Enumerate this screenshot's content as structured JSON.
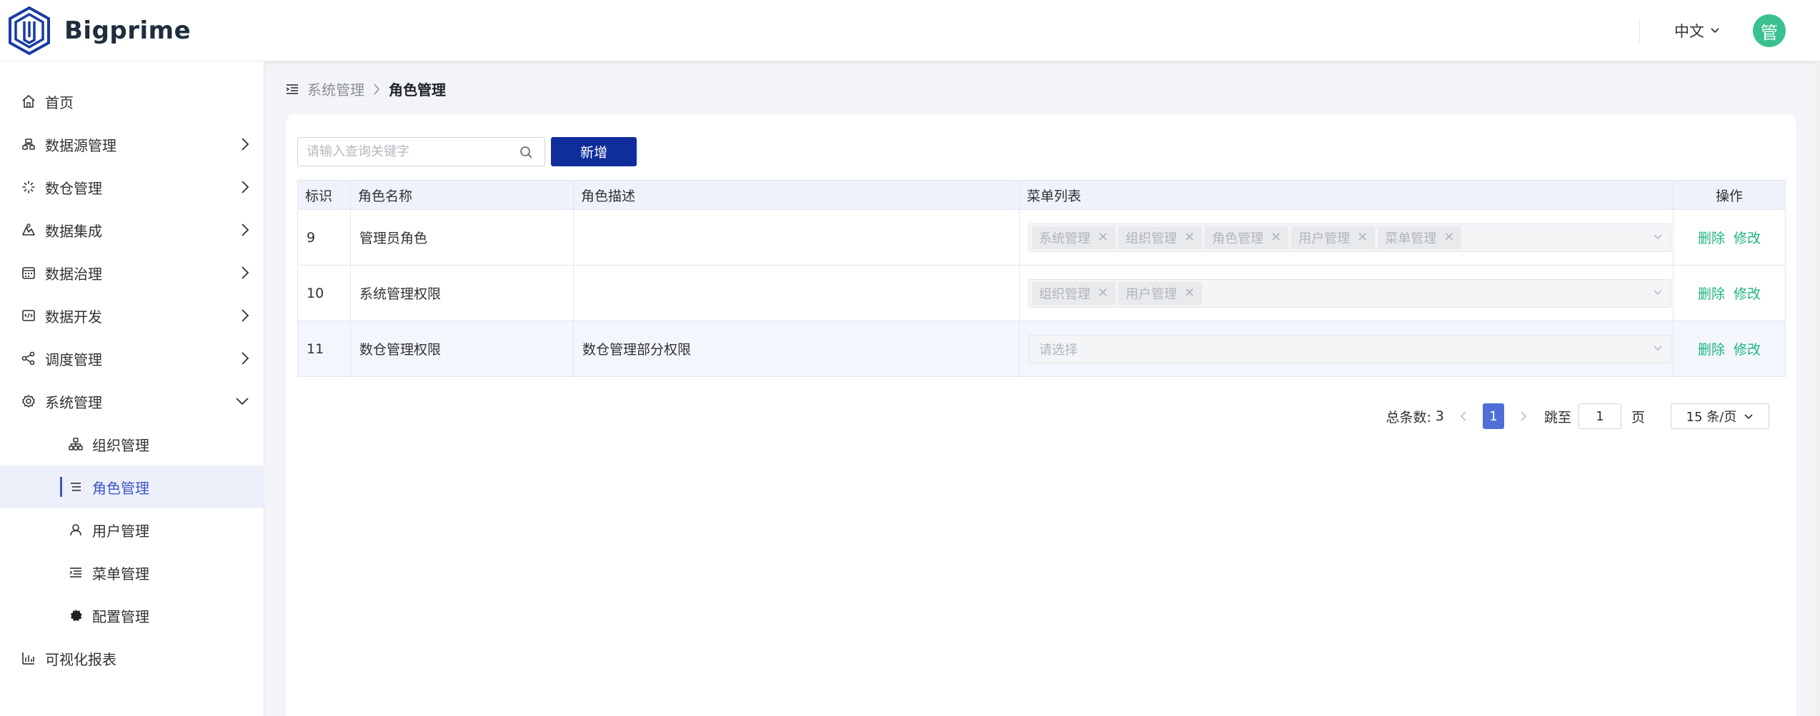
{
  "app": {
    "title": "Bigprime"
  },
  "header": {
    "language": "中文",
    "avatar_text": "管"
  },
  "sidebar": {
    "items": [
      {
        "label": "首页",
        "icon": "home-icon"
      },
      {
        "label": "数据源管理",
        "icon": "datasource-icon"
      },
      {
        "label": "数仓管理",
        "icon": "warehouse-icon"
      },
      {
        "label": "数据集成",
        "icon": "integration-icon"
      },
      {
        "label": "数据治理",
        "icon": "governance-icon"
      },
      {
        "label": "数据开发",
        "icon": "code-icon"
      },
      {
        "label": "调度管理",
        "icon": "share-icon"
      },
      {
        "label": "系统管理",
        "icon": "gear-icon"
      }
    ],
    "sub_items": [
      {
        "label": "组织管理",
        "icon": "org-icon"
      },
      {
        "label": "角色管理",
        "icon": "list-icon",
        "active": true
      },
      {
        "label": "用户管理",
        "icon": "user-icon"
      },
      {
        "label": "菜单管理",
        "icon": "menu-icon"
      },
      {
        "label": "配置管理",
        "icon": "config-icon"
      }
    ],
    "bottom_item": {
      "label": "可视化报表",
      "icon": "chart-icon"
    }
  },
  "breadcrumb": {
    "parent": "系统管理",
    "current": "角色管理"
  },
  "toolbar": {
    "search_placeholder": "请输入查询关键字",
    "add_label": "新增"
  },
  "table": {
    "headers": [
      "标识",
      "角色名称",
      "角色描述",
      "菜单列表",
      "操作"
    ],
    "rows": [
      {
        "id": "9",
        "name": "管理员角色",
        "desc": "",
        "menus": [
          "系统管理",
          "组织管理",
          "角色管理",
          "用户管理",
          "菜单管理"
        ]
      },
      {
        "id": "10",
        "name": "系统管理权限",
        "desc": "",
        "menus": [
          "组织管理",
          "用户管理"
        ]
      },
      {
        "id": "11",
        "name": "数仓管理权限",
        "desc": "数仓管理部分权限",
        "menus": [],
        "placeholder": "请选择"
      }
    ],
    "delete_label": "删除",
    "edit_label": "修改"
  },
  "pagination": {
    "total_label": "总条数:",
    "total": "3",
    "current_page": "1",
    "jump_label": "跳至",
    "jump_value": "1",
    "page_unit": "页",
    "page_size": "15 条/页"
  },
  "colors": {
    "primary": "#0f2e9c",
    "accent": "#3c57c6",
    "success": "#1fb57e",
    "avatar": "#39c28f"
  }
}
